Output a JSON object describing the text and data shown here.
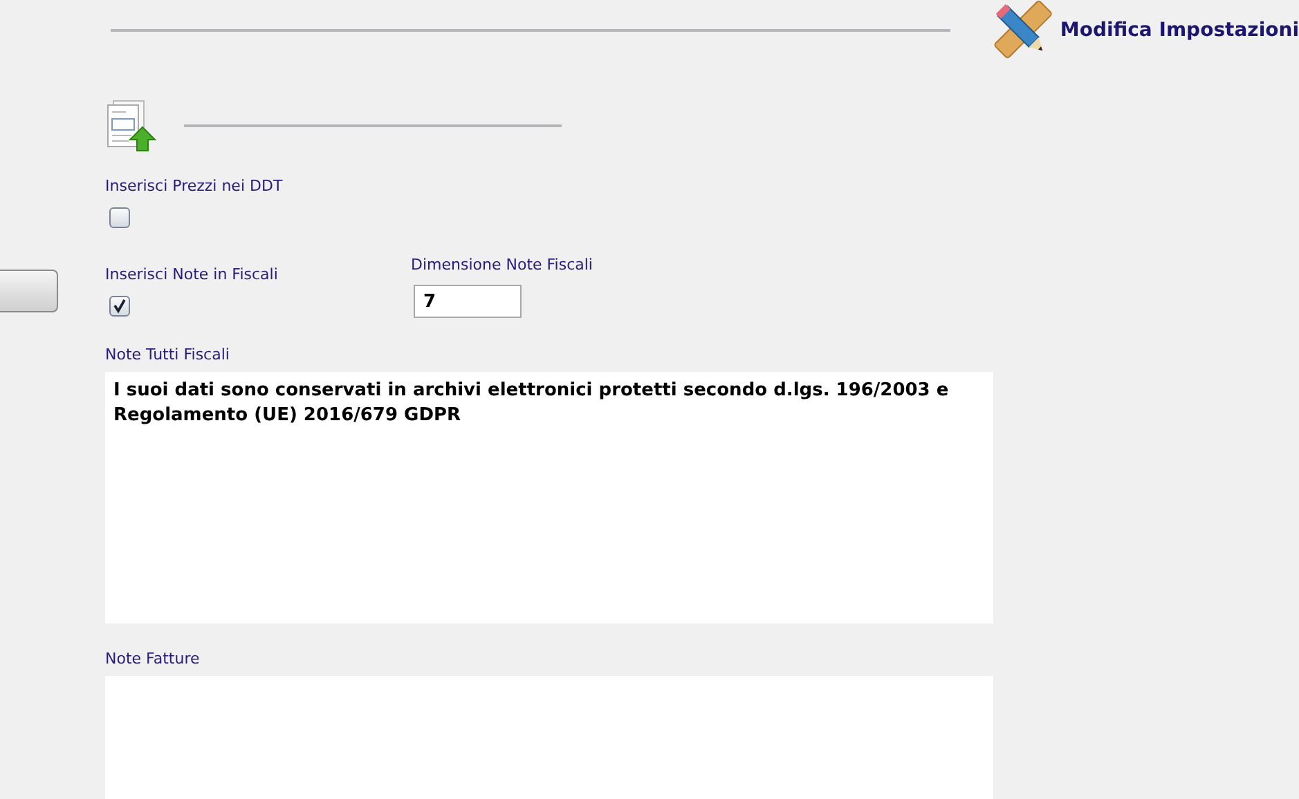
{
  "header": {
    "title": "Modifica Impostazioni"
  },
  "prices_in_ddt": {
    "label": "Inserisci Prezzi nei DDT",
    "checked": false
  },
  "notes_in_fiscal": {
    "label": "Inserisci Note in Fiscali",
    "checked": true
  },
  "notes_size": {
    "label": "Dimensione Note Fiscali",
    "value": "7"
  },
  "all_fiscal_notes": {
    "label": "Note Tutti Fiscali",
    "value": "I suoi dati sono conservati in archivi elettronici protetti secondo d.lgs. 196/2003 e Regolamento (UE) 2016/679 GDPR"
  },
  "invoice_notes": {
    "label": "Note Fatture"
  }
}
